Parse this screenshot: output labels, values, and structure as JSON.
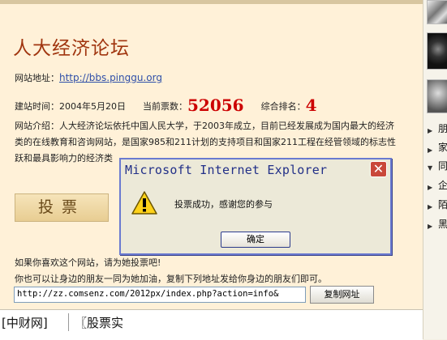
{
  "page": {
    "site_title": "人大经济论坛",
    "url_label": "网站地址：",
    "url_link": "http://bbs.pinggu.org",
    "founded_label": "建站时间：",
    "founded_date": "2004年5月20日",
    "votes_label": "当前票数：",
    "votes_value": "52056",
    "rank_label": "综合排名：",
    "rank_value": "4",
    "intro_lines": [
      "网站介绍：人大经济论坛依托中国人民大学，于2003年成立，目前已经发展成为国内最大的经济",
      "类的在线教育和咨询网站，是国家985和211计划的支持项目和国家211工程在经管领域的标志性",
      "跃和最具影响力的经济类"
    ],
    "vote_button": "投票",
    "share_line1": "如果你喜欢这个网站，请为她投票吧!",
    "share_line2": "你也可以让身边的朋友一同为她加油，复制下列地址发给你身边的朋友们即可。",
    "share_url": "http://zz.comsenz.com/2012px/index.php?action=info&",
    "copy_button": "复制网址"
  },
  "bottom_bar": {
    "tab1": "[中财网]",
    "tab2": "〖股票实"
  },
  "right_panel": {
    "items": [
      "朋",
      "家",
      "同",
      "企",
      "陌",
      "黑"
    ]
  },
  "dialog": {
    "title": "Microsoft Internet Explorer",
    "close_glyph": "✕",
    "message": "投票成功，感谢您的参与",
    "ok_button": "确定"
  }
}
